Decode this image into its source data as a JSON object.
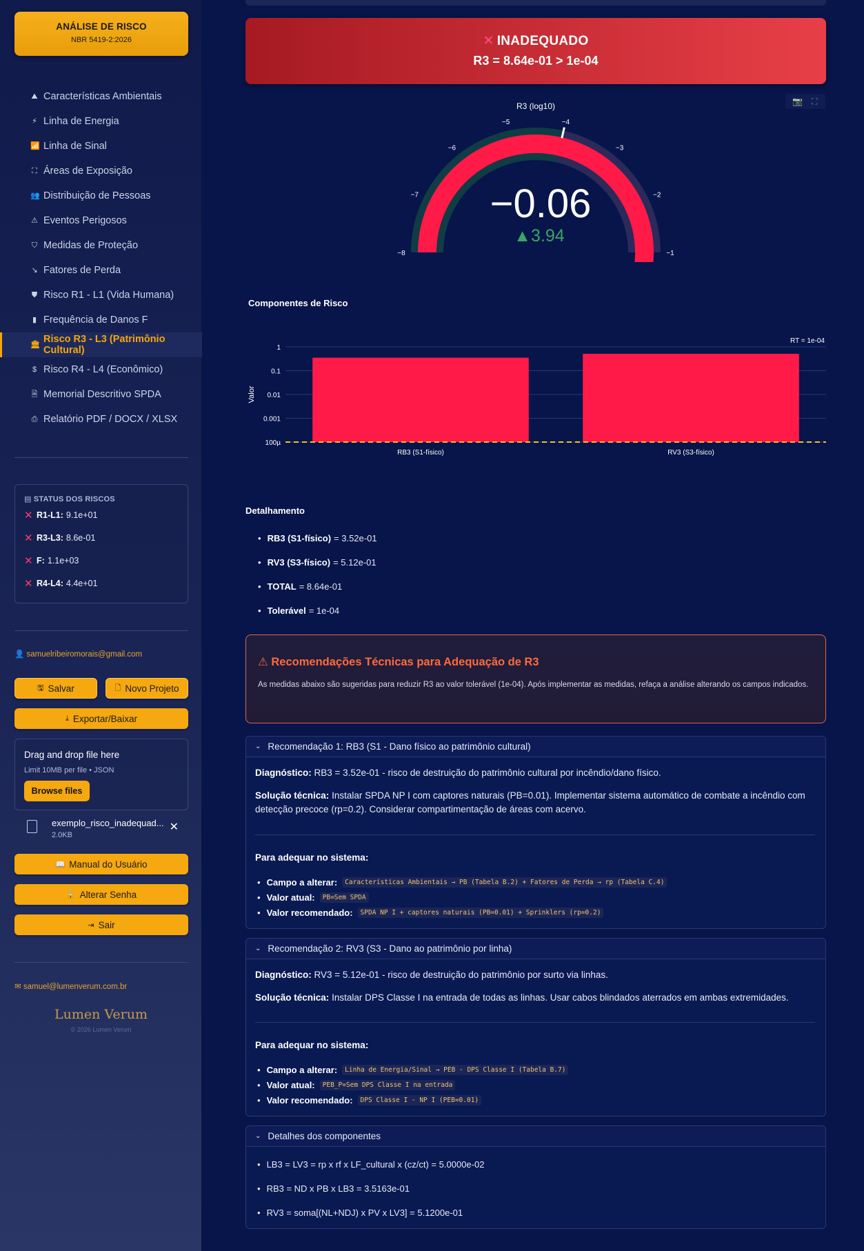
{
  "sidebar": {
    "brand_title": "ANÁLISE DE RISCO",
    "brand_subtitle": "NBR 5419-2:2026",
    "nav": [
      {
        "label": "Características Ambientais",
        "icon": "mountain-icon"
      },
      {
        "label": "Linha de Energia",
        "icon": "plug-icon"
      },
      {
        "label": "Linha de Sinal",
        "icon": "antenna-icon"
      },
      {
        "label": "Áreas de Exposição",
        "icon": "expand-icon"
      },
      {
        "label": "Distribuição de Pessoas",
        "icon": "people-icon"
      },
      {
        "label": "Eventos Perigosos",
        "icon": "warning-icon"
      },
      {
        "label": "Medidas de Proteção",
        "icon": "shield-icon"
      },
      {
        "label": "Fatores de Perda",
        "icon": "trend-down-icon"
      },
      {
        "label": "Risco R1 - L1 (Vida Humana)",
        "icon": "shield-heart-icon"
      },
      {
        "label": "Frequência de Danos F",
        "icon": "bar-chart-icon"
      },
      {
        "label": "Risco R3 - L3 (Patrimônio Cultural)",
        "icon": "museum-icon",
        "active": true
      },
      {
        "label": "Risco R4 - L4 (Econômico)",
        "icon": "dollar-icon"
      },
      {
        "label": "Memorial Descritivo SPDA",
        "icon": "document-icon"
      },
      {
        "label": "Relatório PDF / DOCX / XLSX",
        "icon": "printer-icon"
      }
    ],
    "status_title": "STATUS DOS RISCOS",
    "status": [
      {
        "key": "R1-L1:",
        "value": "9.1e+01"
      },
      {
        "key": "R3-L3:",
        "value": "8.6e-01"
      },
      {
        "key": "F:",
        "value": "1.1e+03"
      },
      {
        "key": "R4-L4:",
        "value": "4.4e+01"
      }
    ],
    "user_email": "samuelribeiromorais@gmail.com",
    "save_label": "Salvar",
    "new_project_label": "Novo Projeto",
    "export_label": "Exportar/Baixar",
    "drop_title": "Drag and drop file here",
    "drop_limit": "Limit 10MB per file • JSON",
    "browse_label": "Browse files",
    "file_name": "exemplo_risco_inadequad...",
    "file_size": "2.0KB",
    "manual_label": "Manual do Usuário",
    "password_label": "Alterar Senha",
    "logout_label": "Sair",
    "contact_email": "samuel@lumenverum.com.br",
    "logo_text": "Lumen Verum",
    "copyright": "© 2026 Lumen Verum"
  },
  "banner": {
    "status": "INADEQUADO",
    "formula": "R3 = 8.64e-01 > 1e-04"
  },
  "gauge": {
    "title": "R3 (log10)",
    "value_label": "−0.06",
    "delta_label": "▲3.94",
    "value": -0.06,
    "threshold": -4,
    "min": -8,
    "max": -1,
    "ticks": [
      "−8",
      "−7",
      "−6",
      "−5",
      "−4",
      "−3",
      "−2",
      "−1"
    ]
  },
  "chart_data": {
    "type": "bar",
    "title": "Componentes de Risco",
    "ylabel": "Valor",
    "yscale": "log",
    "ylim": [
      0.0001,
      1
    ],
    "yticks": [
      "1",
      "0.1",
      "0.01",
      "0.001",
      "100µ"
    ],
    "categories": [
      "RB3 (S1-físico)",
      "RV3 (S3-físico)"
    ],
    "values": [
      0.352,
      0.512
    ],
    "bar_color": "#ff1a47",
    "threshold_label": "RT = 1e-04",
    "threshold": 0.0001,
    "threshold_color": "#f5c518"
  },
  "details": {
    "title": "Detalhamento",
    "items": [
      {
        "key": "RB3 (S1-físico)",
        "value": "= 3.52e-01"
      },
      {
        "key": "RV3 (S3-físico)",
        "value": "= 5.12e-01"
      },
      {
        "key": "TOTAL",
        "value": "= 8.64e-01"
      },
      {
        "key": "Tolerável",
        "value": "= 1e-04"
      }
    ]
  },
  "recommendations": {
    "title": "Recomendações Técnicas para Adequação de R3",
    "description": "As medidas abaixo são sugeridas para reduzir R3 ao valor tolerável (1e-04). Após implementar as medidas, refaça a análise alterando os campos indicados.",
    "diag_label": "Diagnóstico:",
    "solution_label": "Solução técnica:",
    "adequar_label": "Para adequar no sistema:",
    "field_label": "Campo a alterar:",
    "current_label": "Valor atual:",
    "recommended_label": "Valor recomendado:",
    "items": [
      {
        "header": "Recomendação 1: RB3 (S1 - Dano físico ao patrimônio cultural)",
        "diagnosis": "RB3 = 3.52e-01 - risco de destruição do patrimônio cultural por incêndio/dano físico.",
        "solution": "Instalar SPDA NP I com captores naturais (PB=0.01). Implementar sistema automático de combate a incêndio com detecção precoce (rp=0.2). Considerar compartimentação de áreas com acervo.",
        "field": "Características Ambientais → PB (Tabela B.2) + Fatores de Perda → rp (Tabela C.4)",
        "current": "PB=Sem SPDA",
        "recommended": "SPDA NP I + captores naturais (PB=0.01) + Sprinklers (rp=0.2)"
      },
      {
        "header": "Recomendação 2: RV3 (S3 - Dano ao patrimônio por linha)",
        "diagnosis": "RV3 = 5.12e-01 - risco de destruição do patrimônio por surto via linhas.",
        "solution": "Instalar DPS Classe I na entrada de todas as linhas. Usar cabos blindados aterrados em ambas extremidades.",
        "field": "Linha de Energia/Sinal → PEB - DPS Classe I (Tabela B.7)",
        "current": "PEB_P=Sem DPS Classe I na entrada",
        "recommended": "DPS Classe I - NP I (PEB=0.01)"
      }
    ]
  },
  "components": {
    "header": "Detalhes dos componentes",
    "lines": [
      "LB3 = LV3 = rp x rf x LF_cultural x (cz/ct) = 5.0000e-02",
      "RB3 = ND x PB x LB3 = 3.5163e-01",
      "RV3 = soma[(NL+NDJ) x PV x LV3] = 5.1200e-01"
    ]
  }
}
